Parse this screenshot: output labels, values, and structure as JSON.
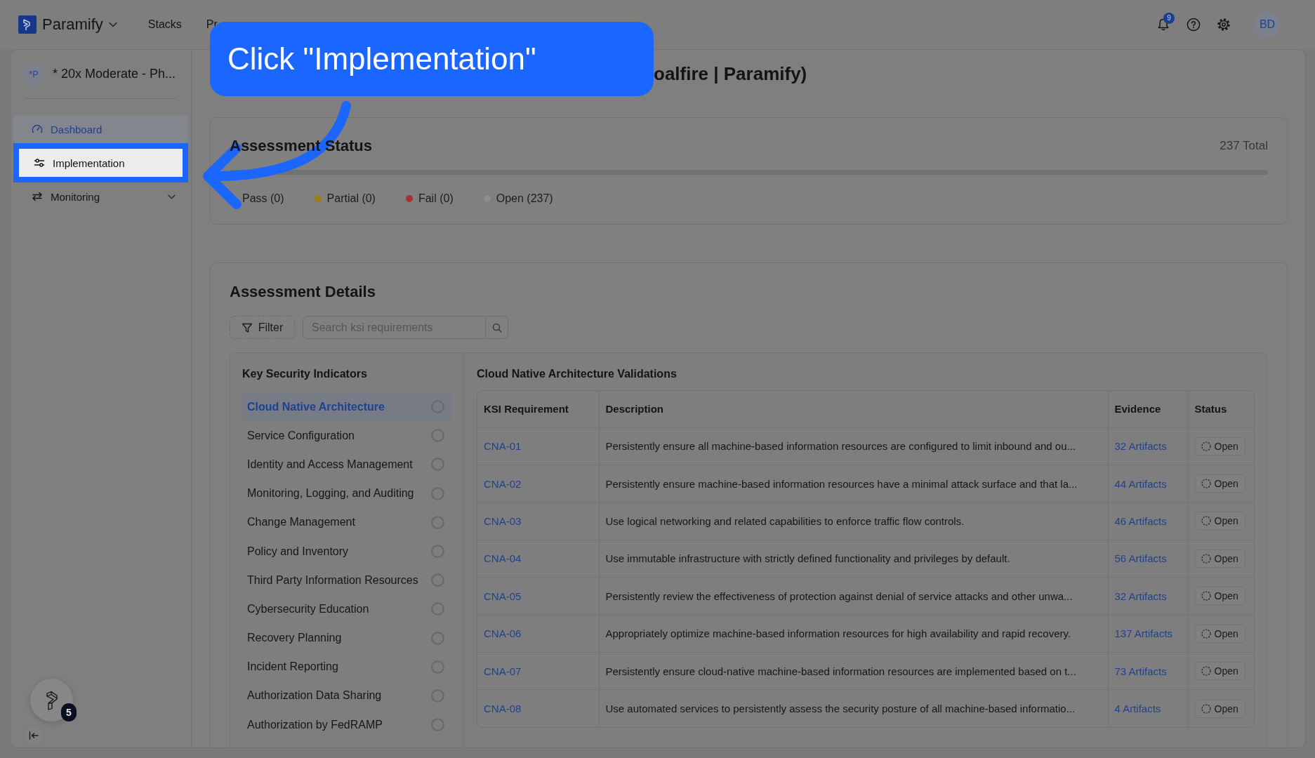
{
  "top_bar": {
    "brand": "Paramify",
    "nav": [
      {
        "label": "Stacks"
      },
      {
        "label": "Pr"
      }
    ],
    "notification_count": "9",
    "user_initials": "BD"
  },
  "sidebar": {
    "project_badge": "*P",
    "project_name": "* 20x Moderate - Ph...",
    "items": [
      {
        "label": "Dashboard",
        "kind": "link",
        "selected": true,
        "highlighted": false
      },
      {
        "label": "Implementation",
        "kind": "link",
        "selected": false,
        "highlighted": true
      },
      {
        "label": "Monitoring",
        "kind": "group",
        "selected": false,
        "highlighted": false
      }
    ],
    "assistant_badge": "5"
  },
  "page_title": "oalfire | Paramify)",
  "assessment_status": {
    "title": "Assessment Status",
    "total": "237 Total",
    "level": 0,
    "legend": [
      {
        "label": "Pass (0)"
      },
      {
        "label": "Partial (0)",
        "color": "#9c7d12"
      },
      {
        "label": "Fail (0)",
        "color": "#a83030"
      },
      {
        "label": "Open (237)",
        "color": "#8e8e8e"
      }
    ]
  },
  "assessment_details": {
    "title": "Assessment Details",
    "filter_label": "Filter",
    "search": {
      "placeholder": "Search ksi requirements"
    },
    "indicators": {
      "title": "Key Security Indicators",
      "items": [
        {
          "label": "Cloud Native Architecture",
          "selected": true
        },
        {
          "label": "Service Configuration",
          "selected": false
        },
        {
          "label": "Identity and Access Management",
          "selected": false
        },
        {
          "label": "Monitoring, Logging, and Auditing",
          "selected": false
        },
        {
          "label": "Change Management",
          "selected": false
        },
        {
          "label": "Policy and Inventory",
          "selected": false
        },
        {
          "label": "Third Party Information Resources",
          "selected": false
        },
        {
          "label": "Cybersecurity Education",
          "selected": false
        },
        {
          "label": "Recovery Planning",
          "selected": false
        },
        {
          "label": "Incident Reporting",
          "selected": false
        },
        {
          "label": "Authorization Data Sharing",
          "selected": false
        },
        {
          "label": "Authorization by FedRAMP",
          "selected": false
        }
      ]
    },
    "validations": {
      "title": "Cloud Native Architecture Validations",
      "columns": [
        "KSI Requirement",
        "Description",
        "Evidence",
        "Status"
      ],
      "rows": [
        {
          "ksi": "CNA-01",
          "description": "Persistently ensure all machine-based information resources are configured to limit inbound and ou...",
          "evidence": "32 Artifacts",
          "status": "Open"
        },
        {
          "ksi": "CNA-02",
          "description": "Persistently ensure machine-based information resources have a minimal attack surface and that la...",
          "evidence": "44 Artifacts",
          "status": "Open"
        },
        {
          "ksi": "CNA-03",
          "description": "Use logical networking and related capabilities to enforce traffic flow controls.",
          "evidence": "46 Artifacts",
          "status": "Open"
        },
        {
          "ksi": "CNA-04",
          "description": "Use immutable infrastructure with strictly defined functionality and privileges by default.",
          "evidence": "56 Artifacts",
          "status": "Open"
        },
        {
          "ksi": "CNA-05",
          "description": "Persistently review the effectiveness of protection against denial of service attacks and other unwa...",
          "evidence": "32 Artifacts",
          "status": "Open"
        },
        {
          "ksi": "CNA-06",
          "description": "Appropriately optimize machine-based information resources for high availability and rapid recovery.",
          "evidence": "137 Artifacts",
          "status": "Open"
        },
        {
          "ksi": "CNA-07",
          "description": "Persistently ensure cloud-native machine-based information resources are implemented based on t...",
          "evidence": "73 Artifacts",
          "status": "Open"
        },
        {
          "ksi": "CNA-08",
          "description": "Use automated services to persistently assess the security posture of all machine-based informatio...",
          "evidence": "4 Artifacts",
          "status": "Open"
        }
      ]
    }
  },
  "tour": {
    "callout": "Click \"Implementation\""
  }
}
